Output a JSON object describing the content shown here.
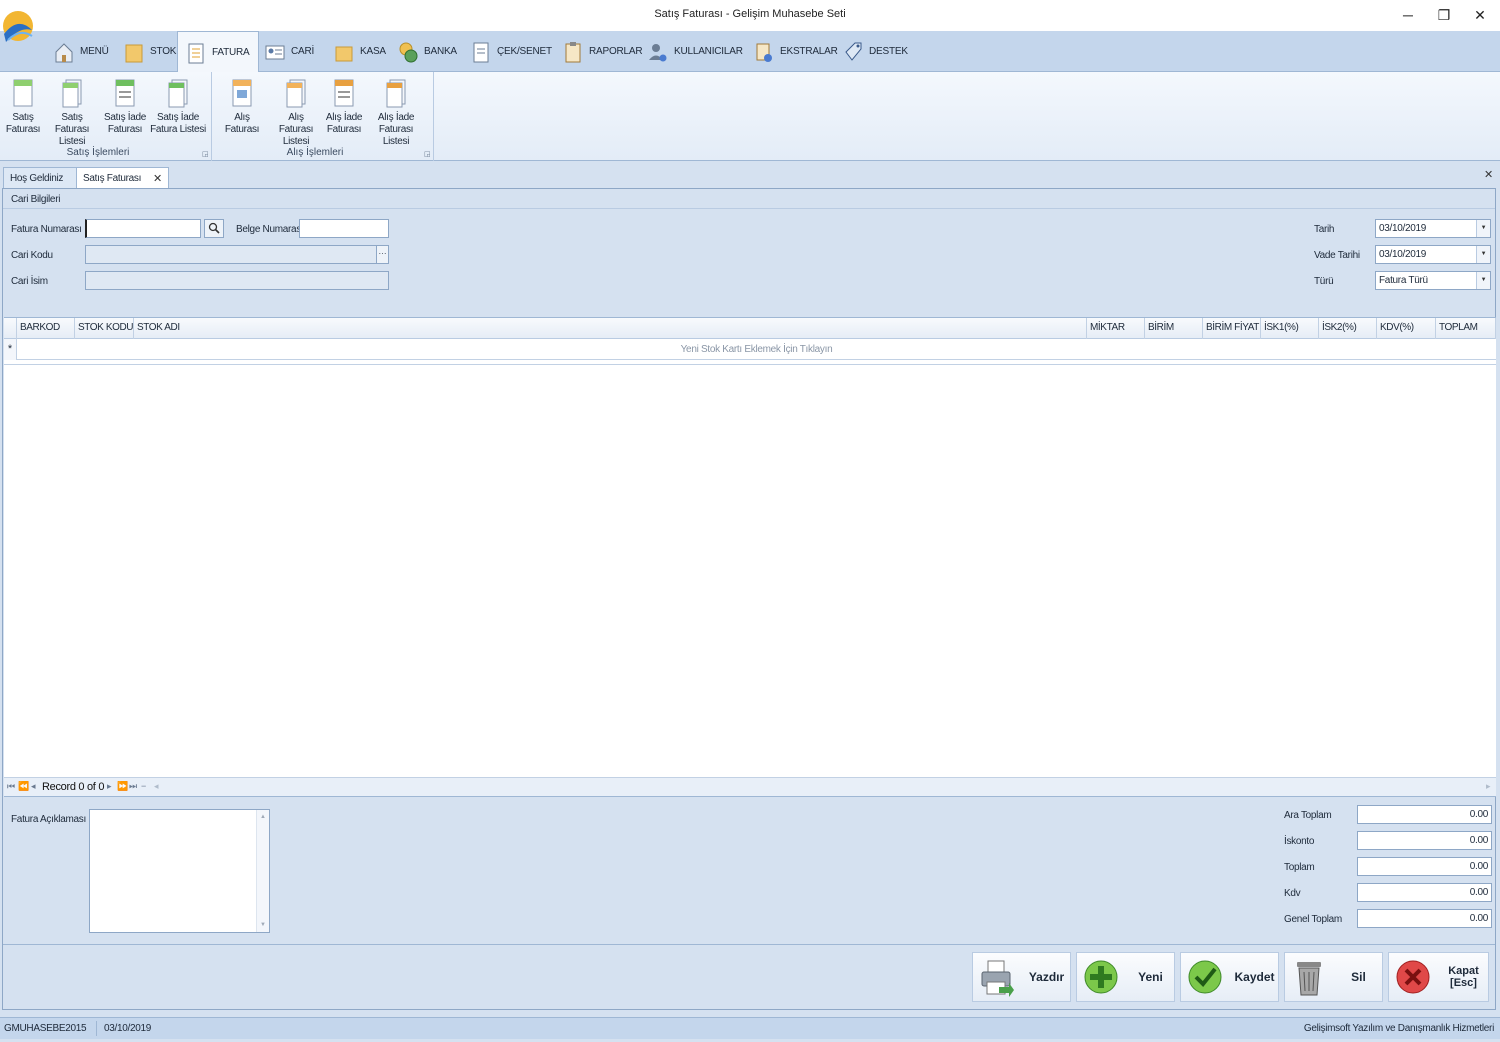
{
  "window": {
    "title": "Satış Faturası - Gelişim Muhasebe Seti",
    "minimize": "─",
    "maximize": "❐",
    "close": "✕"
  },
  "ribbon_tabs": [
    {
      "label": "MENÜ",
      "icon": "home-icon"
    },
    {
      "label": "STOK",
      "icon": "box-icon"
    },
    {
      "label": "FATURA",
      "icon": "invoice-icon"
    },
    {
      "label": "CARİ",
      "icon": "contact-card-icon"
    },
    {
      "label": "KASA",
      "icon": "cash-box-icon"
    },
    {
      "label": "BANKA",
      "icon": "bank-coin-icon"
    },
    {
      "label": "ÇEK/SENET",
      "icon": "cheque-icon"
    },
    {
      "label": "RAPORLAR",
      "icon": "clipboard-icon"
    },
    {
      "label": "KULLANICILAR",
      "icon": "users-gear-icon"
    },
    {
      "label": "EKSTRALAR",
      "icon": "extras-gear-icon"
    },
    {
      "label": "DESTEK",
      "icon": "tag-icon"
    }
  ],
  "ribbon": {
    "groups": [
      {
        "label": "Satış İşlemleri",
        "buttons": [
          {
            "l1": "Satış",
            "l2": "Faturası"
          },
          {
            "l1": "Satış Faturası",
            "l2": "Listesi"
          },
          {
            "l1": "Satış İade",
            "l2": "Faturası"
          },
          {
            "l1": "Satış İade",
            "l2": "Fatura Listesi"
          }
        ]
      },
      {
        "label": "Alış İşlemleri",
        "buttons": [
          {
            "l1": "Alış Faturası",
            "l2": ""
          },
          {
            "l1": "Alış Faturası",
            "l2": "Listesi"
          },
          {
            "l1": "Alış İade",
            "l2": "Faturası"
          },
          {
            "l1": "Alış İade",
            "l2": "Faturası Listesi"
          }
        ]
      }
    ],
    "launcher": "◲"
  },
  "doc_tabs": [
    {
      "label": "Hoş Geldiniz",
      "close": "✕"
    },
    {
      "label": "Satış Faturası",
      "close": "✕"
    }
  ],
  "doc_close": "✕",
  "cari": {
    "group_title": "Cari Bilgileri",
    "fatura_no_label": "Fatura Numarası",
    "fatura_no_value": "",
    "belge_no_label": "Belge Numarası",
    "belge_no_value": "",
    "cari_kodu_label": "Cari Kodu",
    "cari_kodu_value": "",
    "cari_isim_label": "Cari İsim",
    "cari_isim_value": "",
    "ellipsis": "···",
    "tarih_label": "Tarih",
    "tarih_value": "03/10/2019",
    "vade_label": "Vade Tarihi",
    "vade_value": "03/10/2019",
    "turu_label": "Türü",
    "turu_value": "Fatura Türü",
    "dropdown_arrow": "▼"
  },
  "grid": {
    "columns": [
      "BARKOD",
      "STOK KODU",
      "STOK ADI",
      "MİKTAR",
      "BİRİM",
      "BİRİM FİYAT",
      "İSK1(%)",
      "İSK2(%)",
      "KDV(%)",
      "TOPLAM"
    ],
    "new_row_marker": "*",
    "new_row_hint": "Yeni Stok Kartı Eklemek İçin Tıklayın",
    "record_text": "Record 0 of 0",
    "nav": {
      "first": "⏮",
      "prev_page": "⏪",
      "prev": "◂",
      "next": "▸",
      "next_page": "⏩",
      "last": "⏭",
      "delete": "−",
      "scroll_left": "◂",
      "scroll_right": "▸"
    }
  },
  "notes": {
    "label": "Fatura Açıklaması",
    "value": "",
    "scroll_up": "▲",
    "scroll_down": "▼"
  },
  "totals": [
    {
      "label": "Ara Toplam",
      "value": "0.00"
    },
    {
      "label": "İskonto",
      "value": "0.00"
    },
    {
      "label": "Toplam",
      "value": "0.00"
    },
    {
      "label": "Kdv",
      "value": "0.00"
    },
    {
      "label": "Genel Toplam",
      "value": "0.00"
    }
  ],
  "actions": {
    "print": "Yazdır",
    "new": "Yeni",
    "save": "Kaydet",
    "delete": "Sil",
    "close": "Kapat [Esc]"
  },
  "status": {
    "db": "GMUHASEBE2015",
    "date": "03/10/2019",
    "company": "Gelişimsoft Yazılım ve Danışmanlık Hizmetleri"
  }
}
